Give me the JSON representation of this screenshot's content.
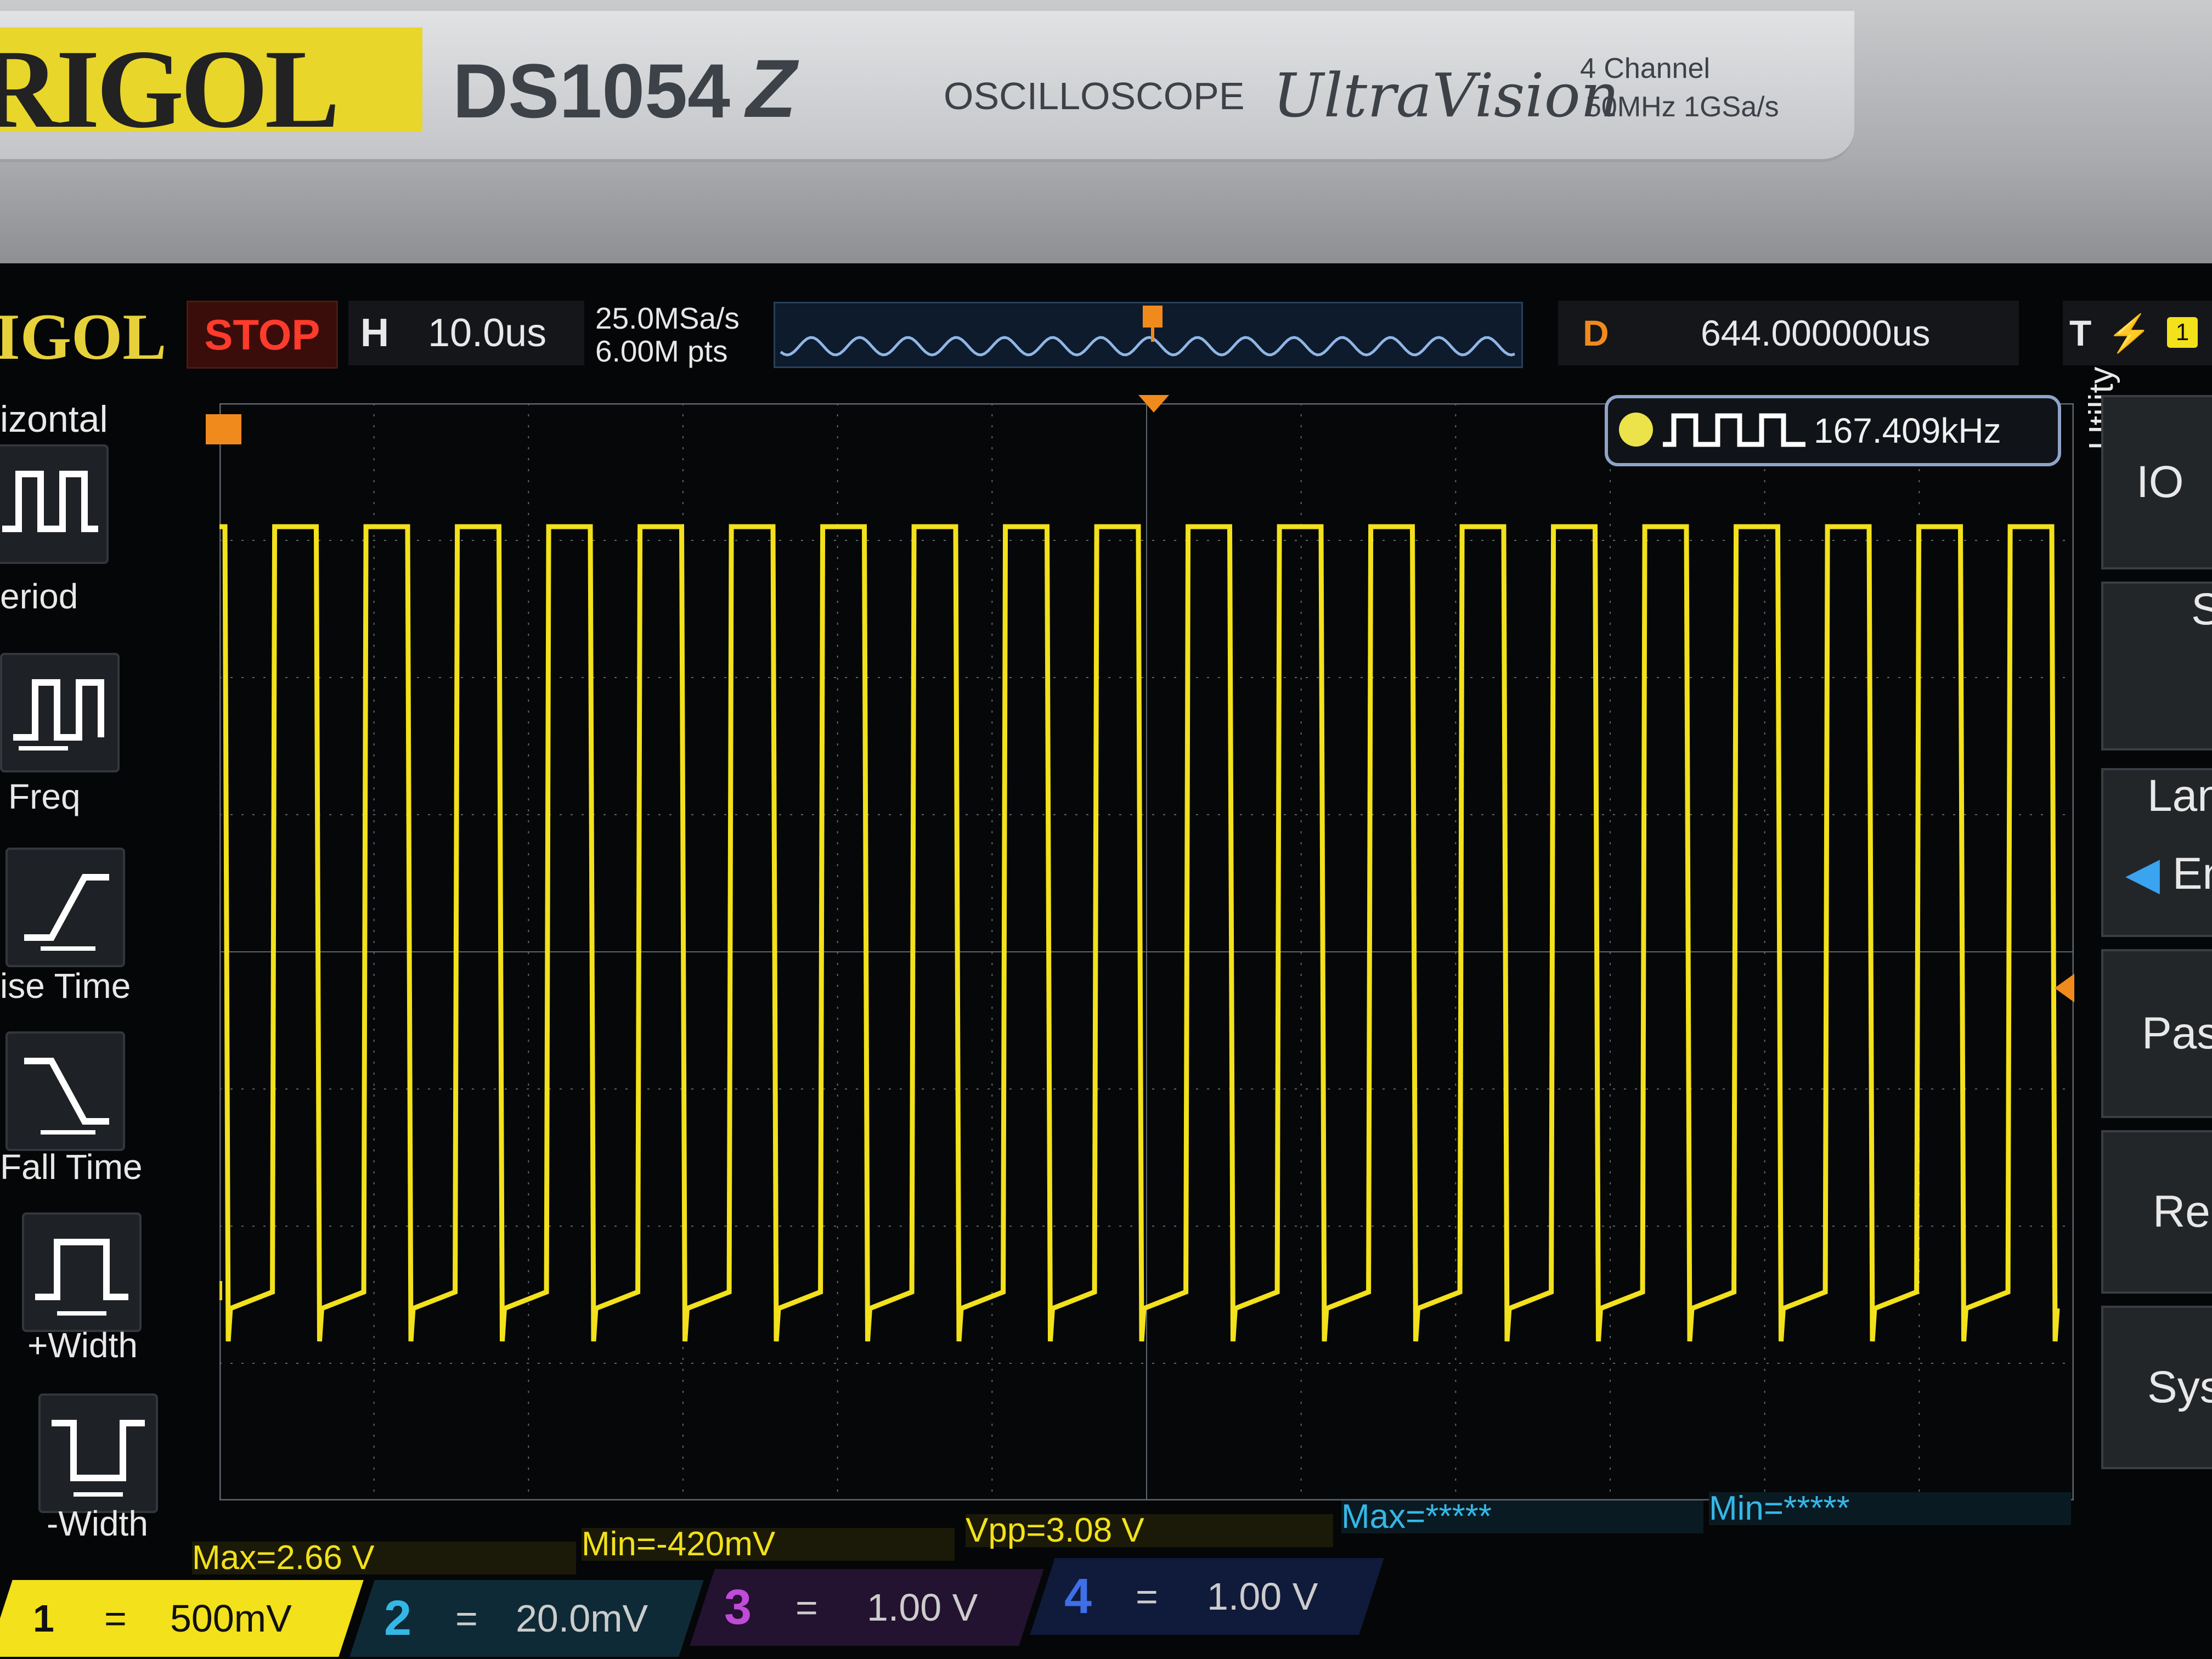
{
  "bezel": {
    "brand": "RIGOL",
    "model": "DS1054",
    "model_suffix": "Z",
    "device_type": "OSCILLOSCOPE",
    "series": "UltraVision",
    "spec_line1": "4 Channel",
    "spec_line2": "50MHz  1GSa/s"
  },
  "topbar": {
    "brand": "IGOL",
    "run_state": "STOP",
    "timebase_label": "H",
    "timebase_value": "10.0us",
    "sample_rate": "25.0MSa/s",
    "memory_depth": "6.00M pts",
    "delay_label": "D",
    "delay_value": "644.000000us",
    "trigger_label": "T",
    "trigger_source": "1"
  },
  "sidebar": {
    "title": "izontal",
    "items": [
      {
        "label": "eriod",
        "icon": "period-icon"
      },
      {
        "label": "Freq",
        "icon": "freq-icon"
      },
      {
        "label": "ise Time",
        "icon": "rise-time-icon"
      },
      {
        "label": "Fall Time",
        "icon": "fall-time-icon"
      },
      {
        "label": "+Width",
        "icon": "pos-width-icon"
      },
      {
        "label": "-Width",
        "icon": "neg-width-icon"
      }
    ]
  },
  "measurement": {
    "channel": "1",
    "value": "167.409kHz"
  },
  "right_menu": {
    "title": "Utility",
    "items": [
      "IO",
      "S",
      "Lan",
      "En",
      "Pas",
      "Re",
      "Sys"
    ]
  },
  "stats": {
    "max1": "Max=2.66 V",
    "min1": "Min=-420mV",
    "vpp1": "Vpp=3.08 V",
    "max2": "Max=*****",
    "min2": "Min=*****"
  },
  "channels": [
    {
      "num": "1",
      "coupling": "=",
      "scale": "500mV",
      "color": "#f2e11b"
    },
    {
      "num": "2",
      "coupling": "=",
      "scale": "20.0mV",
      "color": "#35b7e6"
    },
    {
      "num": "3",
      "coupling": "=",
      "scale": "1.00 V",
      "color": "#c04bd8"
    },
    {
      "num": "4",
      "coupling": "=",
      "scale": "1.00 V",
      "color": "#3e6fe8"
    }
  ],
  "colors": {
    "ch1": "#f2e11b",
    "grid": "#5f6670",
    "trigger": "#f08a1c",
    "stop": "#ff3b2c"
  }
}
